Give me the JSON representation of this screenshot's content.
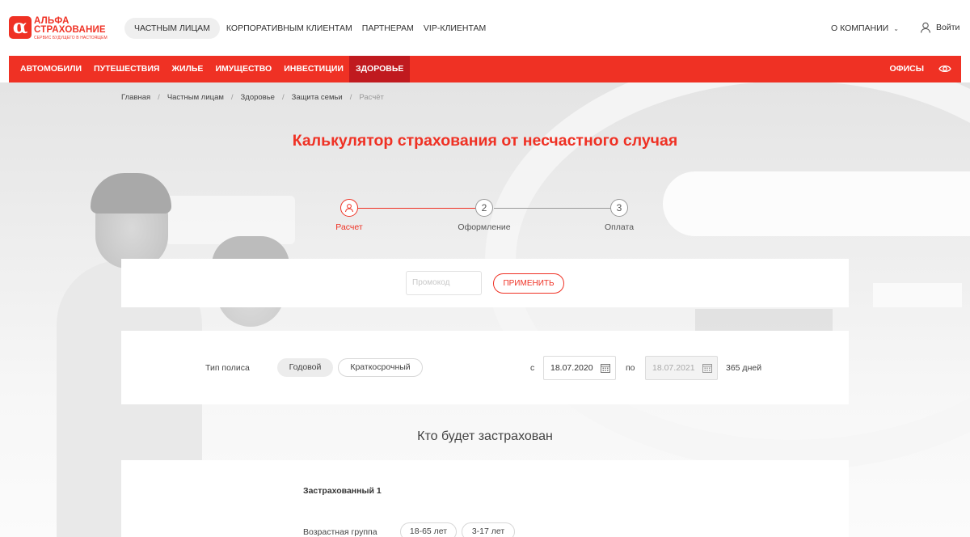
{
  "header": {
    "logo_line1": "АЛЬФА",
    "logo_line2": "СТРАХОВАНИЕ",
    "logo_tagline": "СЕРВИС БУДУЩЕГО В НАСТОЯЩЕМ",
    "logo_mark": "α",
    "segments": [
      {
        "label": "ЧАСТНЫМ ЛИЦАМ",
        "active": true
      },
      {
        "label": "КОРПОРАТИВНЫМ КЛИЕНТАМ",
        "active": false
      },
      {
        "label": "ПАРТНЕРАМ",
        "active": false
      },
      {
        "label": "VIP-КЛИЕНТАМ",
        "active": false
      }
    ],
    "company_label": "О КОМПАНИИ",
    "login_label": "Войти"
  },
  "nav": {
    "items": [
      {
        "label": "АВТОМОБИЛИ",
        "active": false
      },
      {
        "label": "ПУТЕШЕСТВИЯ",
        "active": false
      },
      {
        "label": "ЖИЛЬЕ",
        "active": false
      },
      {
        "label": "ИМУЩЕСТВО",
        "active": false
      },
      {
        "label": "ИНВЕСТИЦИИ",
        "active": false
      },
      {
        "label": "ЗДОРОВЬЕ",
        "active": true
      }
    ],
    "offices_label": "ОФИСЫ"
  },
  "breadcrumb": [
    "Главная",
    "Частным лицам",
    "Здоровье",
    "Защита семьи",
    "Расчёт"
  ],
  "page_title": "Калькулятор страхования от несчастного случая",
  "steps": [
    {
      "number": "1",
      "label": "Расчет",
      "active": true
    },
    {
      "number": "2",
      "label": "Оформление",
      "active": false
    },
    {
      "number": "3",
      "label": "Оплата",
      "active": false
    }
  ],
  "promo": {
    "placeholder": "Промокод",
    "apply_label": "ПРИМЕНИТЬ"
  },
  "policy": {
    "type_label": "Тип полиса",
    "options": [
      "Годовой",
      "Краткосрочный"
    ],
    "selected": "Годовой",
    "from_label": "с",
    "from_date": "18.07.2020",
    "to_label": "по",
    "to_date": "18.07.2021",
    "duration": "365 дней"
  },
  "insured_section": {
    "title": "Кто будет застрахован",
    "person_title": "Застрахованный 1",
    "age_group_label": "Возрастная группа",
    "age_groups": [
      "18-65 лет",
      "3-17 лет"
    ]
  },
  "colors": {
    "brand_red": "#ef3124",
    "nav_active": "#c01a1f"
  }
}
